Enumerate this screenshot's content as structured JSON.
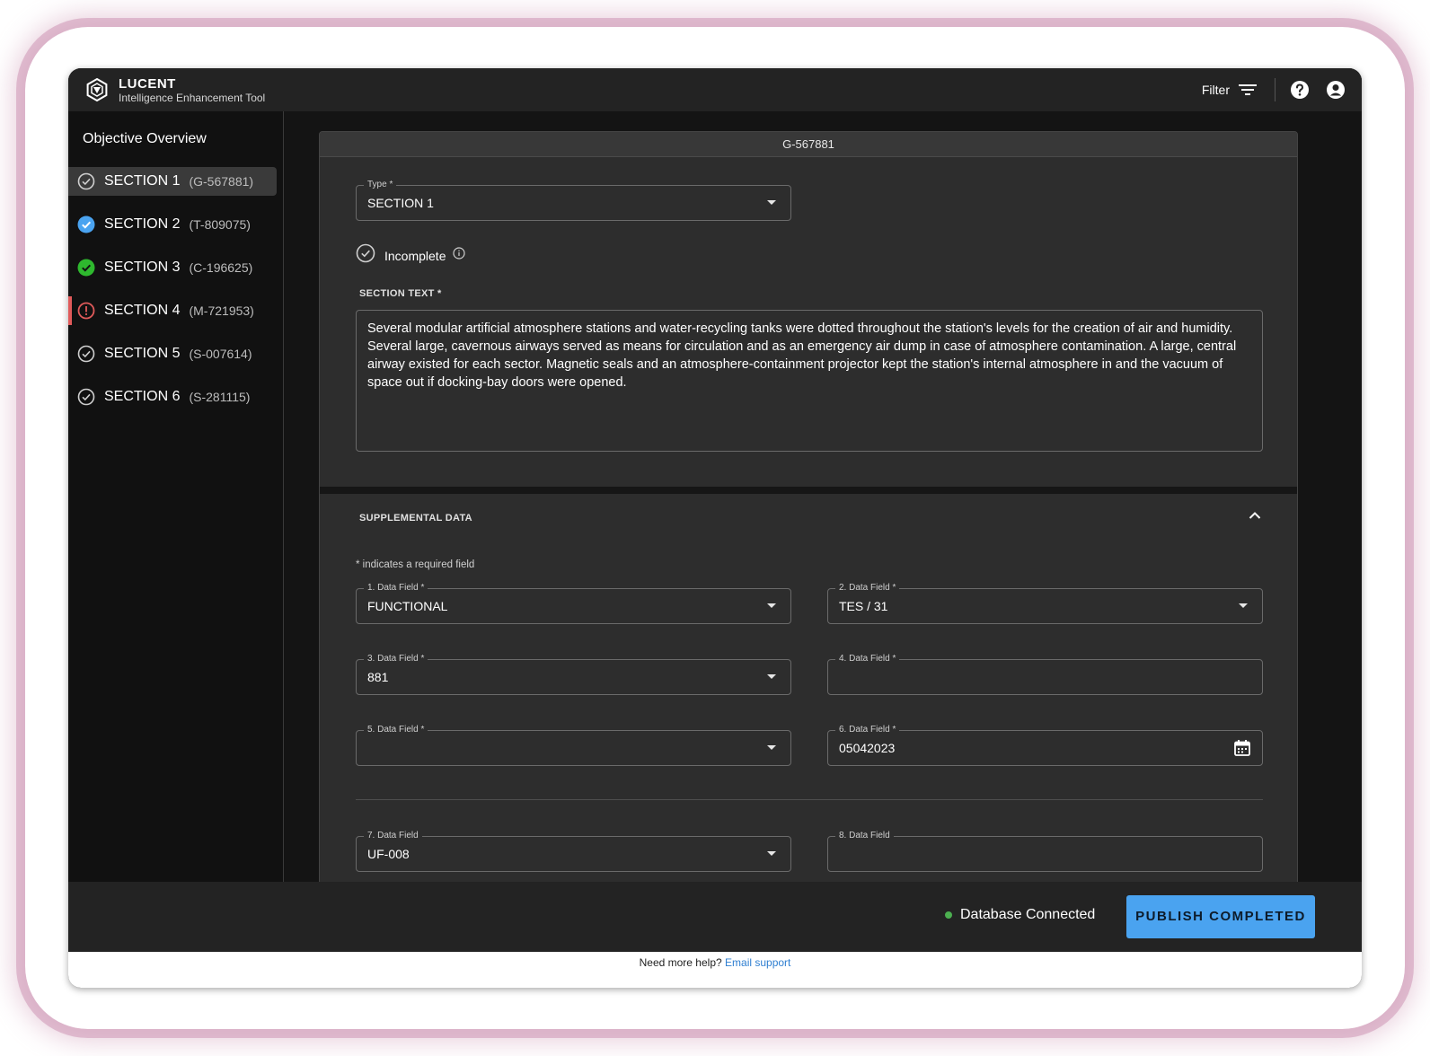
{
  "app": {
    "brand_name": "LUCENT",
    "brand_subtitle": "Intelligence Enhancement Tool",
    "filter_label": "Filter"
  },
  "sidebar": {
    "title": "Objective Overview",
    "items": [
      {
        "label": "SECTION 1",
        "code": "(G-567881)",
        "status": "outline-check",
        "active": true
      },
      {
        "label": "SECTION 2",
        "code": "(T-809075)",
        "status": "blue-check"
      },
      {
        "label": "SECTION 3",
        "code": "(C-196625)",
        "status": "green-check"
      },
      {
        "label": "SECTION 4",
        "code": "(M-721953)",
        "status": "error"
      },
      {
        "label": "SECTION 5",
        "code": "(S-007614)",
        "status": "outline-check"
      },
      {
        "label": "SECTION 6",
        "code": "(S-281115)",
        "status": "outline-check"
      }
    ]
  },
  "card": {
    "header": "G-567881",
    "type_field": {
      "label": "Type *",
      "value": "SECTION 1"
    },
    "status_label": "Incomplete",
    "section_text_label": "SECTION TEXT *",
    "section_text": "Several modular artificial atmosphere stations and water-recycling tanks were dotted throughout the station's levels for the creation of air and humidity. Several large, cavernous airways served as means for circulation and as an emergency air dump in case of atmosphere contamination. A large, central airway existed for each sector. Magnetic seals and an atmosphere-containment projector kept the station's internal atmosphere in and the vacuum of space out if docking-bay doors were opened."
  },
  "supplemental": {
    "title": "SUPPLEMENTAL DATA",
    "required_note": "* indicates a required field",
    "fields": [
      {
        "label": "1. Data Field *",
        "value": "FUNCTIONAL"
      },
      {
        "label": "2. Data Field *",
        "value": "TES / 31"
      },
      {
        "label": "3. Data Field *",
        "value": "881"
      },
      {
        "label": "4. Data Field *",
        "value": ""
      },
      {
        "label": "5. Data Field *",
        "value": ""
      },
      {
        "label": "6. Data Field *",
        "value": "05042023"
      },
      {
        "label": "7. Data Field",
        "value": "UF-008"
      },
      {
        "label": "8. Data Field",
        "value": ""
      }
    ]
  },
  "footer": {
    "db_status": "Database Connected",
    "publish_label": "PUBLISH COMPLETED",
    "help_text": "Need more help?",
    "help_link": "Email support"
  },
  "colors": {
    "accent": "#4aa3f0",
    "success": "#2eb82e",
    "error": "#e05a5a",
    "connected": "#4caf50"
  }
}
